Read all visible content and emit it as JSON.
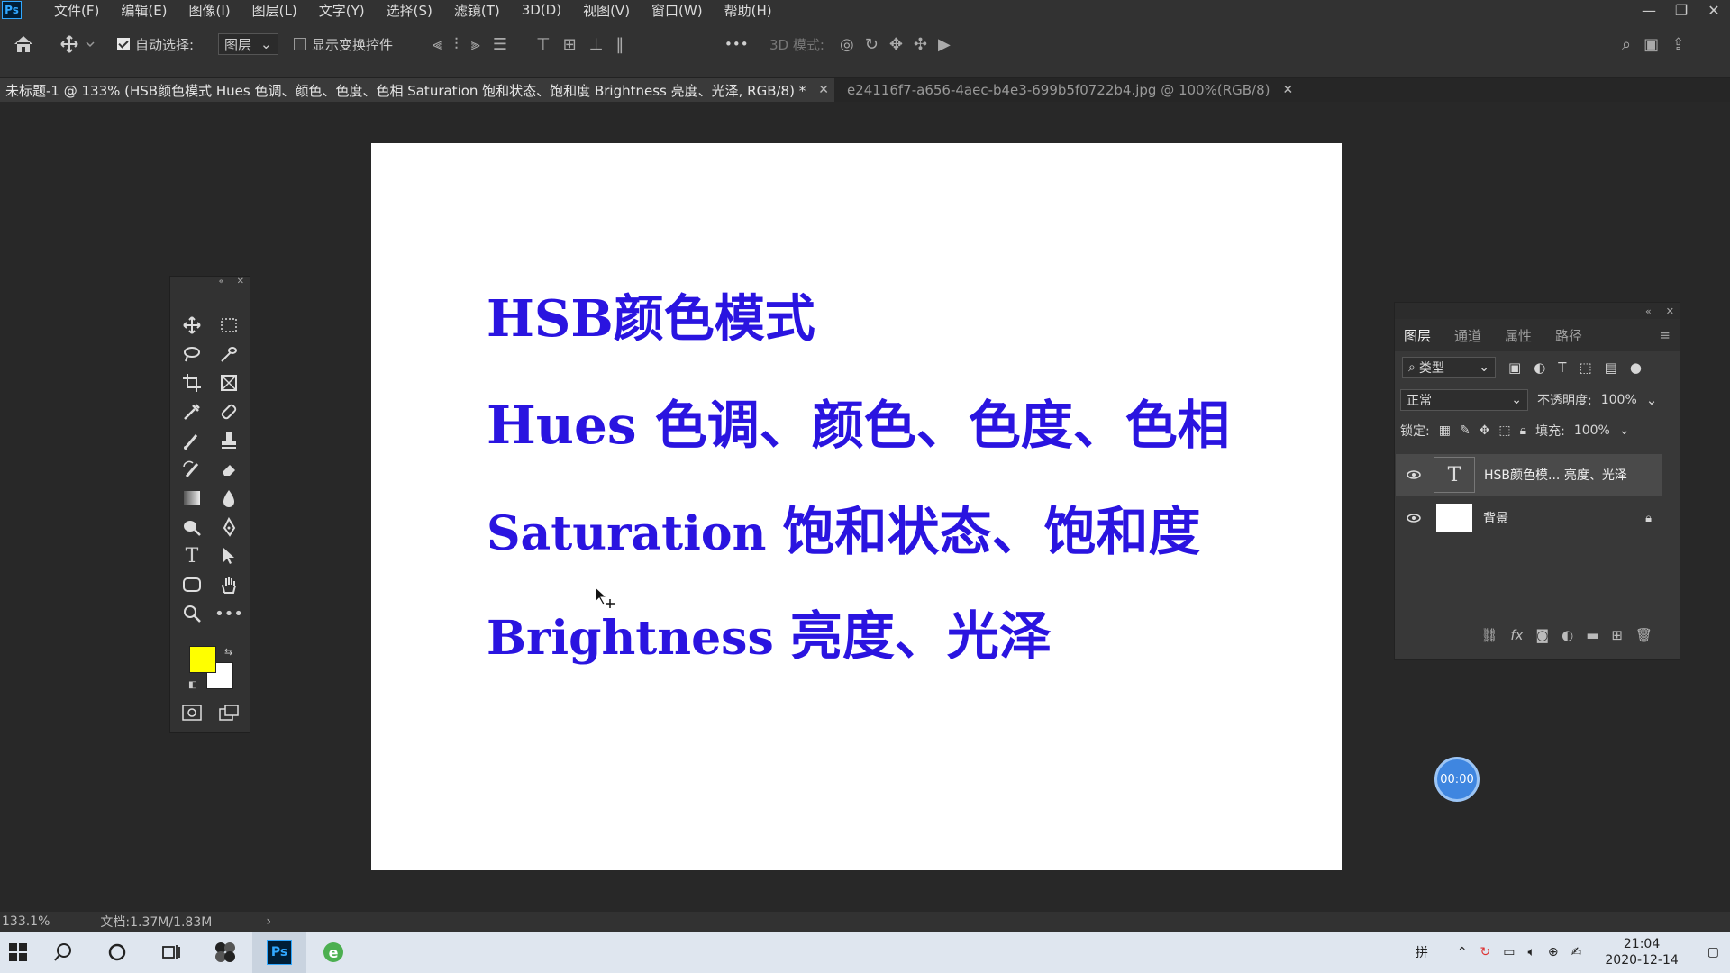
{
  "app": {
    "logo": "Ps"
  },
  "menu": [
    "文件(F)",
    "编辑(E)",
    "图像(I)",
    "图层(L)",
    "文字(Y)",
    "选择(S)",
    "滤镜(T)",
    "3D(D)",
    "视图(V)",
    "窗口(W)",
    "帮助(H)"
  ],
  "options": {
    "auto_select_label": "自动选择:",
    "auto_select_checked": true,
    "auto_select_target": "图层",
    "show_transform_label": "显示变换控件",
    "show_transform_checked": false,
    "more_label": "•••",
    "mode_3d_label": "3D 模式:"
  },
  "tabs": [
    {
      "label": "未标题-1 @ 133% (HSB颜色模式 Hues 色调、颜色、色度、色相 Saturation 饱和状态、饱和度 Brightness 亮度、光泽, RGB/8) *",
      "active": true
    },
    {
      "label": "e24116f7-a656-4aec-b4e3-699b5f0722b4.jpg @ 100%(RGB/8)",
      "active": false
    }
  ],
  "canvas_text": {
    "line1": {
      "latin": "HSB",
      "cjk": "颜色模式"
    },
    "line2": {
      "latin": "Hues",
      "cjk": "色调、颜色、色度、色相"
    },
    "line3": {
      "latin": "Saturation",
      "cjk": "饱和状态、饱和度"
    },
    "line4": {
      "latin": "Brightness",
      "cjk": "亮度、光泽"
    }
  },
  "colors": {
    "foreground": "#ffff00",
    "background": "#ffffff",
    "text": "#2a14e0",
    "timer": "#3f86e0"
  },
  "layers_panel": {
    "tabs": [
      "图层",
      "通道",
      "属性",
      "路径"
    ],
    "filter_label": "类型",
    "blend_mode": "正常",
    "opacity_label": "不透明度:",
    "opacity_value": "100%",
    "lock_label": "锁定:",
    "fill_label": "填充:",
    "fill_value": "100%",
    "layers": [
      {
        "name": "HSB颜色模... 亮度、光泽",
        "type": "text",
        "selected": true
      },
      {
        "name": "背景",
        "type": "background",
        "locked": true
      }
    ]
  },
  "status": {
    "zoom": "133.1%",
    "doc_info": "文档:1.37M/1.83M",
    "arrow": "›"
  },
  "timer": {
    "label": "00:00"
  },
  "taskbar": {
    "ime": "拼",
    "time": "21:04",
    "date": "2020-12-14"
  }
}
